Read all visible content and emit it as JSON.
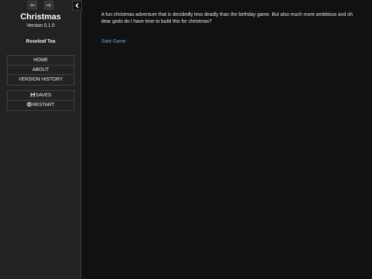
{
  "sidebar": {
    "title": "Christmas",
    "version": "Version 0.1.0",
    "author": "Roseleaf Tea",
    "story_menu": [
      {
        "label": "HOME"
      },
      {
        "label": "ABOUT"
      },
      {
        "label": "VERSION HISTORY"
      }
    ],
    "core_menu": [
      {
        "label": "SAVES",
        "icon": "save-icon"
      },
      {
        "label": "RESTART",
        "icon": "restart-icon"
      }
    ],
    "history": {
      "back_icon": "arrow-left-icon",
      "forward_icon": "arrow-right-icon"
    },
    "toggle_icon": "chevron-left-icon"
  },
  "passage": {
    "text": "A fun christmas adventure that is decidedly less deadly than the birthday game. But also much more ambitious and oh dear gods do I have time to build this for christmas?",
    "link": "Start Game"
  },
  "colors": {
    "background": "#111111",
    "sidebar": "#222222",
    "border": "#444444",
    "link": "#68a6e8",
    "text": "#eeeeee"
  }
}
